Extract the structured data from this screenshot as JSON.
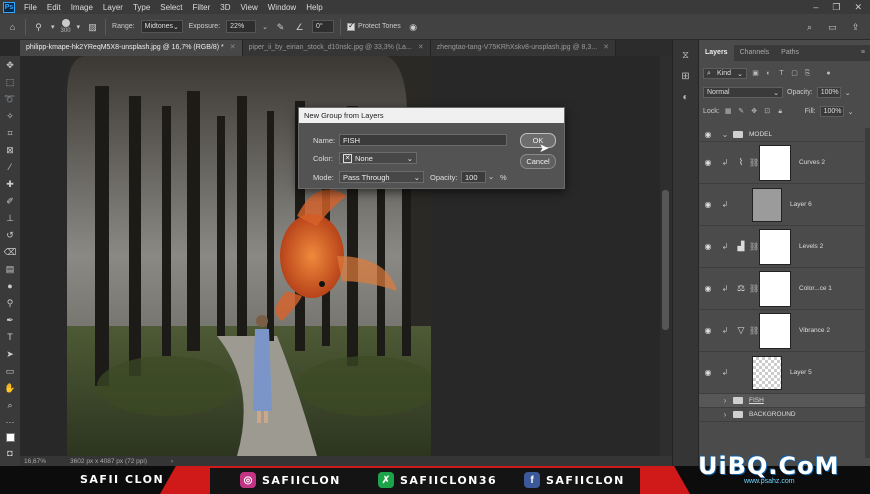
{
  "menu": {
    "app_icon": "Ps",
    "items": [
      "File",
      "Edit",
      "Image",
      "Layer",
      "Type",
      "Select",
      "Filter",
      "3D",
      "View",
      "Window",
      "Help"
    ]
  },
  "options": {
    "brush_size": "300",
    "range_label": "Range:",
    "range_value": "Midtones",
    "exposure_label": "Exposure:",
    "exposure_value": "22%",
    "angle_value": "0°",
    "protect_tones_label": "Protect Tones"
  },
  "tabs": [
    {
      "label": "philipp-kmape-hk2YReqM5X8-unsplash.jpg @ 16,7% (RGB/8) *",
      "active": true
    },
    {
      "label": "piper_ii_by_eirian_stock_d10nslc.jpg @ 33,3% (La...",
      "active": false
    },
    {
      "label": "zhengtao-tang-V75KRhXskv8-unsplash.jpg @ 8,3...",
      "active": false
    }
  ],
  "status": {
    "zoom": "16,67%",
    "doc_size": "3602 px x 4087 px (72 ppi)"
  },
  "dialog": {
    "title": "New Group from Layers",
    "name_label": "Name:",
    "name_value": "FISH",
    "color_label": "Color:",
    "color_value": "None",
    "mode_label": "Mode:",
    "mode_value": "Pass Through",
    "opacity_label": "Opacity:",
    "opacity_value": "100",
    "opacity_unit": "%",
    "ok_label": "OK",
    "cancel_label": "Cancel"
  },
  "panel": {
    "tabs": [
      "Layers",
      "Channels",
      "Paths"
    ],
    "kind_label": "Kind",
    "blend_mode": "Normal",
    "opacity_label": "Opacity:",
    "opacity_value": "100%",
    "lock_label": "Lock:",
    "fill_label": "Fill:",
    "fill_value": "100%"
  },
  "layers": [
    {
      "name": "MODEL",
      "type": "group"
    },
    {
      "name": "Curves 2",
      "type": "adjustment",
      "icon": "curves-icon"
    },
    {
      "name": "Layer 6",
      "type": "image"
    },
    {
      "name": "Levels 2",
      "type": "adjustment",
      "icon": "levels-icon"
    },
    {
      "name": "Color...ce 1",
      "type": "adjustment",
      "icon": "color-balance-icon"
    },
    {
      "name": "Vibrance 2",
      "type": "adjustment",
      "icon": "vibrance-icon"
    },
    {
      "name": "Layer 5",
      "type": "transparent"
    },
    {
      "name": "FISH",
      "type": "group"
    },
    {
      "name": "BACKGROUND",
      "type": "group"
    }
  ],
  "banner": {
    "left_name": "SAFII CLON",
    "instagram": "SAFIICLON",
    "twitter": "SAFIICLON36",
    "facebook": "SAFIICLON",
    "logo": "UiBQ.CoM",
    "logo_sub": "www.psahz.com"
  },
  "colors": {
    "accent_red": "#d01a1a",
    "ps_blue": "#31a8ff",
    "dialog_bg": "#535353"
  }
}
